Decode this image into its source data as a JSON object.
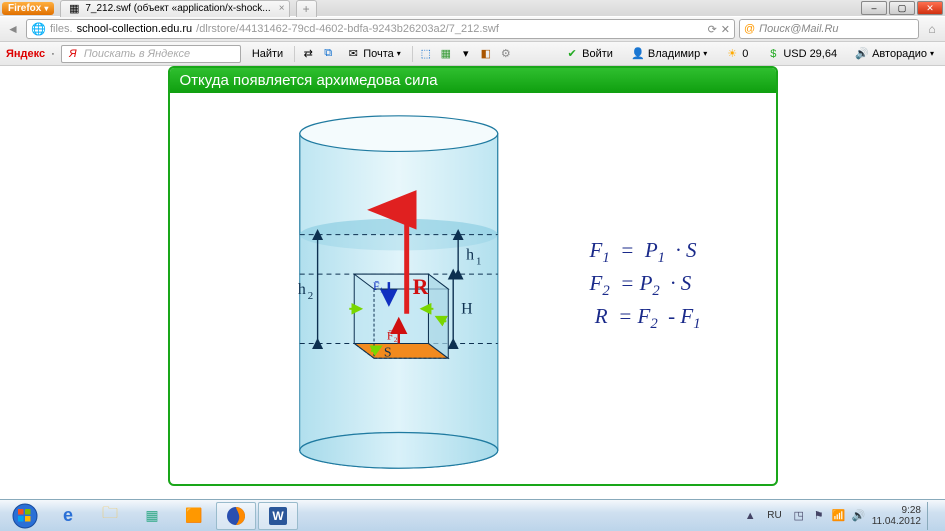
{
  "window": {
    "app_name": "Firefox",
    "tab_title": "7_212.swf (объект «application/x-shock...",
    "buttons": {
      "min": "–",
      "max": "▢",
      "close": "✕"
    }
  },
  "urlbar": {
    "back": "◄",
    "url_prefix": "files.",
    "url_host": "school-collection.edu.ru",
    "url_path": "/dlrstore/44131462-79cd-4602-bdfa-9243b26203a2/7_212.swf",
    "refresh": "⟳",
    "stop": "✕",
    "search_placeholder": "Поиск@Mail.Ru",
    "home": "⌂"
  },
  "yandex_bar": {
    "brand": "Яндекс",
    "search_placeholder": "Поискать в Яндексе",
    "find_btn": "Найти",
    "mail_label": "Почта",
    "login_label": "Войти",
    "user": "Владимир",
    "weather": "0",
    "usd_label": "USD",
    "usd_value": "29,64",
    "radio": "Авторадио"
  },
  "lesson": {
    "title": "Откуда появляется архимедова сила",
    "labels": {
      "h1": "h₁",
      "h2": "h₂",
      "H": "H",
      "R": "R",
      "F1v": "F₁",
      "F2v": "F₂",
      "S": "S"
    },
    "equations": {
      "eq1_lhs": "F",
      "eq1_sub": "1",
      "eq1_rhs_a": "P",
      "eq1_rhs_a_sub": "1",
      "eq1_rhs_b": "S",
      "eq2_lhs": "F",
      "eq2_sub": "2",
      "eq2_rhs_a": "P",
      "eq2_rhs_a_sub": "2",
      "eq2_rhs_b": "S",
      "eq3_lhs": "R",
      "eq3_rhs_a": "F",
      "eq3_rhs_a_sub": "2",
      "eq3_rhs_b": "F",
      "eq3_rhs_b_sub": "1"
    }
  },
  "taskbar": {
    "lang": "RU",
    "time": "9:28",
    "date": "11.04.2012"
  },
  "chart_data": {
    "type": "diagram",
    "title": "Откуда появляется архимедова сила",
    "description": "Цилиндр с жидкостью, внутри погружён куб. Показаны глубины h1 (верхняя грань), h2 (нижняя грань), высота куба H, площадь основания S, силы давления F1 (вниз на верхнюю грань) и F2 (вверх на нижнюю грань), результирующая R = F2 - F1 направлена вверх.",
    "relations": [
      "F1 = P1 · S",
      "F2 = P2 · S",
      "R = F2 - F1"
    ]
  }
}
